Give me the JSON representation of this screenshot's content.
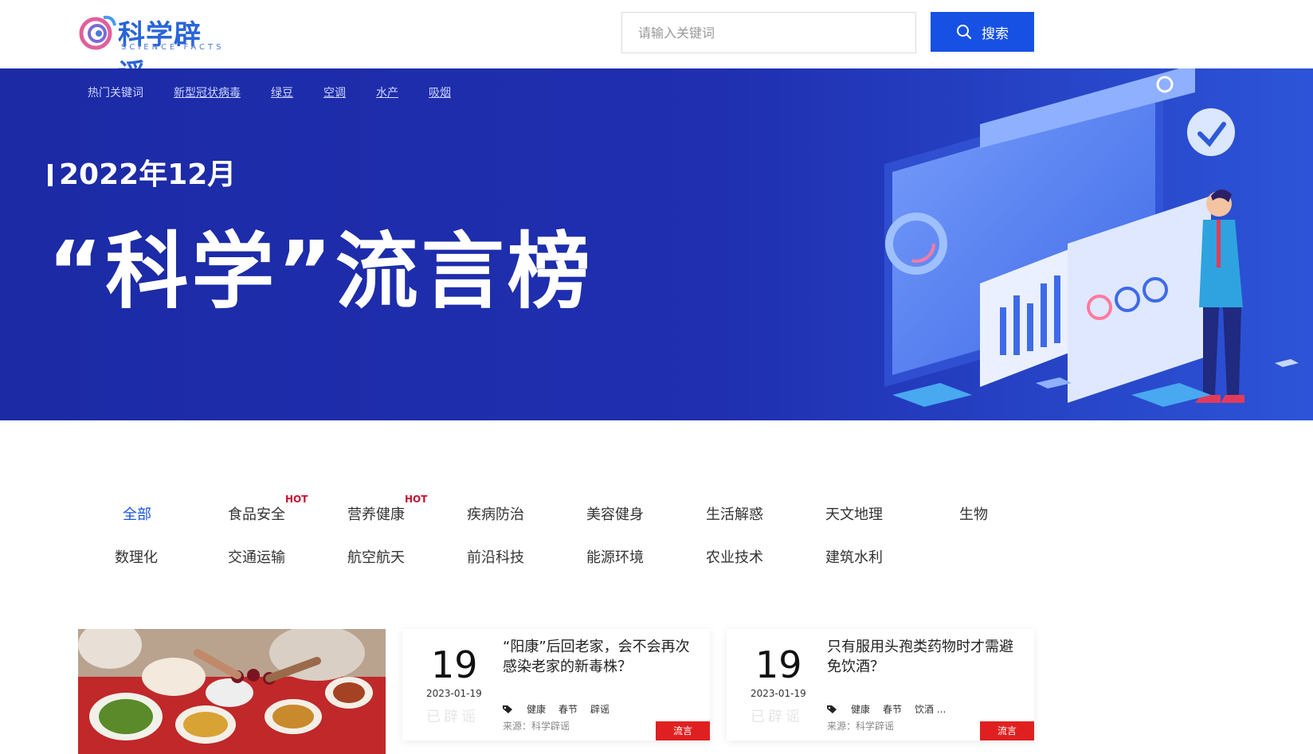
{
  "header": {
    "logo_title": "科学辟谣",
    "logo_sub": "SCIENCE FACTS",
    "search_placeholder": "请输入关键词",
    "search_button": "搜索"
  },
  "banner": {
    "hot_label": "热门关键词",
    "hot_keywords": [
      "新型冠状病毒",
      "绿豆",
      "空调",
      "水产",
      "吸烟"
    ],
    "date": "2022年12月",
    "title": "“科学”流言榜"
  },
  "categories": {
    "row1": [
      "全部",
      "食品安全",
      "营养健康",
      "疾病防治",
      "美容健身",
      "生活解惑",
      "天文地理",
      "生物"
    ],
    "row2": [
      "数理化",
      "交通运输",
      "航空航天",
      "前沿科技",
      "能源环境",
      "农业技术",
      "建筑水利"
    ],
    "hot_badge": "HOT",
    "active": "全部"
  },
  "cards": [
    {
      "day": "19",
      "date": "2023-01-19",
      "stamp": "已辟谣",
      "title": "“阳康”后回老家，会不会再次感染老家的新毒株？",
      "tags": [
        "健康",
        "春节",
        "辟谣"
      ],
      "source": "来源：科学辟谣",
      "badge": "流言"
    },
    {
      "day": "19",
      "date": "2023-01-19",
      "stamp": "已辟谣",
      "title": "只有服用头孢类药物时才需避免饮酒？",
      "tags": [
        "健康",
        "春节",
        "饮酒 ..."
      ],
      "source": "来源：科学辟谣",
      "badge": "流言"
    }
  ],
  "colors": {
    "brand_blue": "#1751e4",
    "banner_blue": "#1f2fb0",
    "hot_red": "#c8102e",
    "badge_red": "#e02020"
  }
}
